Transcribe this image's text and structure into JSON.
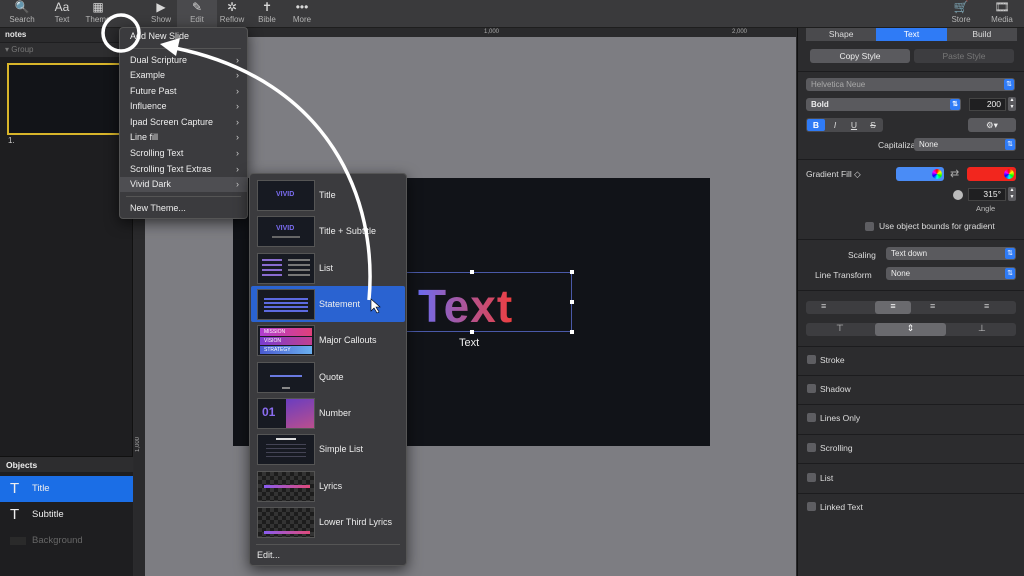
{
  "toolbar": {
    "items": [
      {
        "label": "Search",
        "icon": "search-icon",
        "glyph": "🔍"
      },
      {
        "label": "Text",
        "icon": "text-icon",
        "glyph": "Aa"
      },
      {
        "label": "Theme",
        "icon": "theme-icon",
        "glyph": "▦"
      },
      {
        "label": "Show",
        "icon": "play-icon",
        "glyph": "▶"
      },
      {
        "label": "Edit",
        "icon": "edit-icon",
        "glyph": "✎"
      },
      {
        "label": "Reflow",
        "icon": "reflow-icon",
        "glyph": "✲"
      },
      {
        "label": "Bible",
        "icon": "bible-icon",
        "glyph": "✝"
      },
      {
        "label": "More",
        "icon": "more-icon",
        "glyph": "•••"
      },
      {
        "label": "Store",
        "icon": "store-icon",
        "glyph": "🛒"
      },
      {
        "label": "Media",
        "icon": "media-icon",
        "glyph": "🎞"
      }
    ]
  },
  "left": {
    "notes": "notes",
    "group": "Group",
    "slide_number": "1.",
    "objects_header": "Objects",
    "objects": [
      "Title",
      "Subtitle",
      "Background"
    ]
  },
  "canvas": {
    "ruler_top": [
      "1,000",
      "2,000"
    ],
    "ruler_left": "1,000",
    "big_text": "Text",
    "text_label": "Text"
  },
  "menu": {
    "items": [
      {
        "label": "Add New Slide",
        "sub": false
      },
      {
        "label": "Dual Scripture",
        "sub": true
      },
      {
        "label": "Example",
        "sub": true
      },
      {
        "label": "Future Past",
        "sub": true
      },
      {
        "label": "Influence",
        "sub": true
      },
      {
        "label": "Ipad Screen Capture",
        "sub": true
      },
      {
        "label": "Line fill",
        "sub": true
      },
      {
        "label": "Scrolling Text",
        "sub": true
      },
      {
        "label": "Scrolling Text Extras",
        "sub": true
      },
      {
        "label": "Vivid Dark",
        "sub": true
      },
      {
        "label": "New Theme...",
        "sub": false
      }
    ],
    "sub_arrow": "›"
  },
  "submenu": {
    "items": [
      "Title",
      "Title + Subtitle",
      "List",
      "Statement",
      "Major Callouts",
      "Quote",
      "Number",
      "Simple List",
      "Lyrics",
      "Lower Third Lyrics"
    ],
    "thumb_vivid": "VIVID",
    "thumb_callouts": [
      "MISSION",
      "VISION",
      "STRATEGY"
    ],
    "thumb_number": "01",
    "edit": "Edit..."
  },
  "inspector": {
    "tabs": [
      "Shape",
      "Text",
      "Build"
    ],
    "copy_style": "Copy Style",
    "paste_style": "Paste Style",
    "font": "Helvetica Neue",
    "weight": "Bold",
    "size": "200",
    "format_buttons": [
      "B",
      "I",
      "U",
      "S"
    ],
    "capitalization_label": "Capitalization",
    "capitalization_value": "None",
    "gradient_label": "Gradient Fill ◇",
    "angle_value": "315°",
    "angle_label": "Angle",
    "object_bounds": "Use object bounds for gradient",
    "scaling_label": "Scaling",
    "scaling_value": "Text down",
    "line_transform_label": "Line Transform",
    "line_transform_value": "None",
    "options": [
      "Stroke",
      "Shadow",
      "Lines Only",
      "Scrolling",
      "List",
      "Linked Text"
    ]
  },
  "colors": {
    "accent": "#2f7bf6",
    "gradient_start": "#4a8cf6",
    "gradient_end": "#f2261e"
  }
}
